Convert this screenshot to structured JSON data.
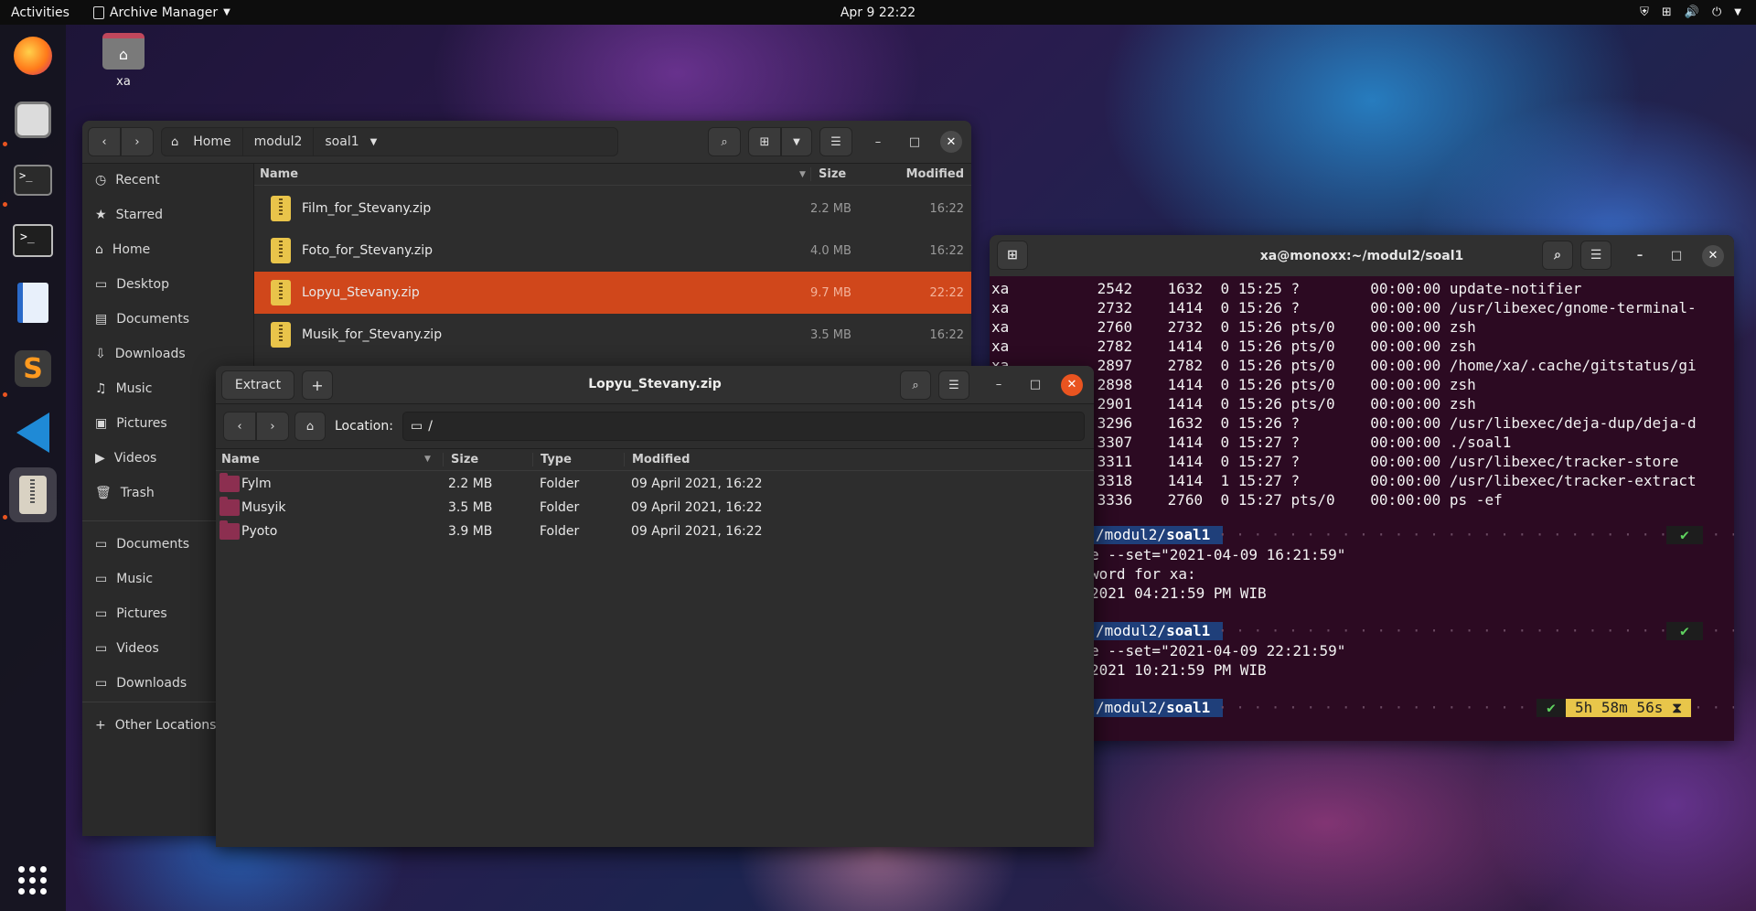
{
  "topbar": {
    "activities": "Activities",
    "app_menu": "Archive Manager",
    "clock": "Apr 9  22:22"
  },
  "desktop": {
    "home_icon_label": "xa"
  },
  "nautilus": {
    "crumbs": [
      "Home",
      "modul2",
      "soal1"
    ],
    "sidebar": [
      "Recent",
      "Starred",
      "Home",
      "Desktop",
      "Documents",
      "Downloads",
      "Music",
      "Pictures",
      "Videos",
      "Trash"
    ],
    "bookmarks": [
      "Documents",
      "Music",
      "Pictures",
      "Videos",
      "Downloads"
    ],
    "other_locations": "Other Locations",
    "columns": {
      "name": "Name",
      "size": "Size",
      "modified": "Modified"
    },
    "files": [
      {
        "name": "Film_for_Stevany.zip",
        "size": "2.2 MB",
        "modified": "16:22"
      },
      {
        "name": "Foto_for_Stevany.zip",
        "size": "4.0 MB",
        "modified": "16:22"
      },
      {
        "name": "Lopyu_Stevany.zip",
        "size": "9.7 MB",
        "modified": "22:22"
      },
      {
        "name": "Musik_for_Stevany.zip",
        "size": "3.5 MB",
        "modified": "16:22"
      }
    ]
  },
  "archive": {
    "title": "Lopyu_Stevany.zip",
    "extract_label": "Extract",
    "location_label": "Location:",
    "location_value": "/",
    "columns": {
      "name": "Name",
      "size": "Size",
      "type": "Type",
      "modified": "Modified"
    },
    "rows": [
      {
        "name": "Fylm",
        "size": "2.2 MB",
        "type": "Folder",
        "modified": "09 April 2021, 16:22"
      },
      {
        "name": "Musyik",
        "size": "3.5 MB",
        "type": "Folder",
        "modified": "09 April 2021, 16:22"
      },
      {
        "name": "Pyoto",
        "size": "3.9 MB",
        "type": "Folder",
        "modified": "09 April 2021, 16:22"
      }
    ]
  },
  "terminal": {
    "title": "xa@monoxx:~/modul2/soal1",
    "process_lines": [
      "xa          2542    1632  0 15:25 ?        00:00:00 update-notifier",
      "xa          2732    1414  0 15:26 ?        00:00:00 /usr/libexec/gnome-terminal-",
      "xa          2760    2732  0 15:26 pts/0    00:00:00 zsh",
      "xa          2782    1414  0 15:26 pts/0    00:00:00 zsh",
      "xa          2897    2782  0 15:26 pts/0    00:00:00 /home/xa/.cache/gitstatus/gi",
      "xa          2898    1414  0 15:26 pts/0    00:00:00 zsh",
      "xa          2901    1414  0 15:26 pts/0    00:00:00 zsh",
      "xa          3296    1632  0 15:26 ?        00:00:00 /usr/libexec/deja-dup/deja-d",
      "xa          3307    1414  0 15:27 ?        00:00:00 ./soal1",
      "xa          3311    1414  0 15:27 ?        00:00:00 /usr/libexec/tracker-store",
      "xa          3318    1414  1 15:27 ?        00:00:00 /usr/libexec/tracker-extract",
      "xa          3336    2760  0 15:27 pts/0    00:00:00 ps -ef"
    ],
    "prompt_path_prefix": "/modul2/",
    "prompt_dir": "soal1",
    "check": "✔",
    "session1": [
      "e --set=\"2021-04-09 16:21:59\"",
      "word for xa:",
      "2021 04:21:59 PM WIB"
    ],
    "session2": [
      "e --set=\"2021-04-09 22:21:59\"",
      "2021 10:21:59 PM WIB"
    ],
    "timer": "5h 58m 56s"
  }
}
